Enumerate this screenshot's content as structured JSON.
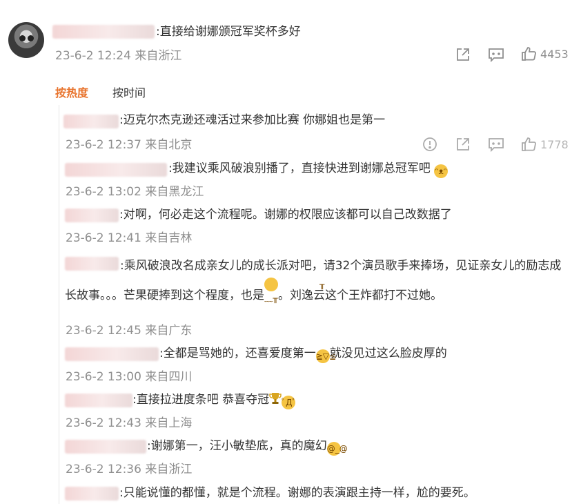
{
  "post": {
    "text": ":直接给谢娜颁冠军奖杯多好",
    "meta": "23-6-2 12:24 来自浙江",
    "like_count": "4453"
  },
  "sort": {
    "hot": "按热度",
    "time": "按时间"
  },
  "comments": [
    {
      "text": ":迈克尔杰克逊还魂活过来参加比赛 你娜姐也是第一",
      "meta": "23-6-2 12:37 来自北京",
      "like_count": "1778"
    },
    {
      "text": ":我建议乘风破浪别播了，直接快进到谢娜总冠军吧",
      "meta": "23-6-2 13:02 来自黑龙江"
    },
    {
      "text": ":对啊，何必走这个流程呢。谢娜的权限应该都可以自己改数据了",
      "meta": "23-6-2 12:41 来自吉林"
    },
    {
      "text_a": ":乘风破浪改名成亲女儿的成长派对吧，请32个演员歌手来捧场，见证亲女儿的励志成长故事。。。芒果硬捧到这个程度，也是",
      "text_b": "。刘逸云这个王炸都打不过她。",
      "meta": "23-6-2 12:45 来自广东"
    },
    {
      "text_a": ":全都是骂她的，还喜爱度第一",
      "text_b": "就没见过这么脸皮厚的",
      "meta": "23-6-2 13:00 来自四川"
    },
    {
      "text": ":直接拉进度条吧 恭喜夺冠",
      "meta": "23-6-2 12:43 来自上海"
    },
    {
      "text": ":谢娜第一，汪小敏垫底，真的魔幻",
      "meta": "23-6-2 12:36 来自浙江"
    },
    {
      "text": ":只能说懂的都懂，就是个流程。谢娜的表演跟主持一样，尬的要死。"
    }
  ]
}
